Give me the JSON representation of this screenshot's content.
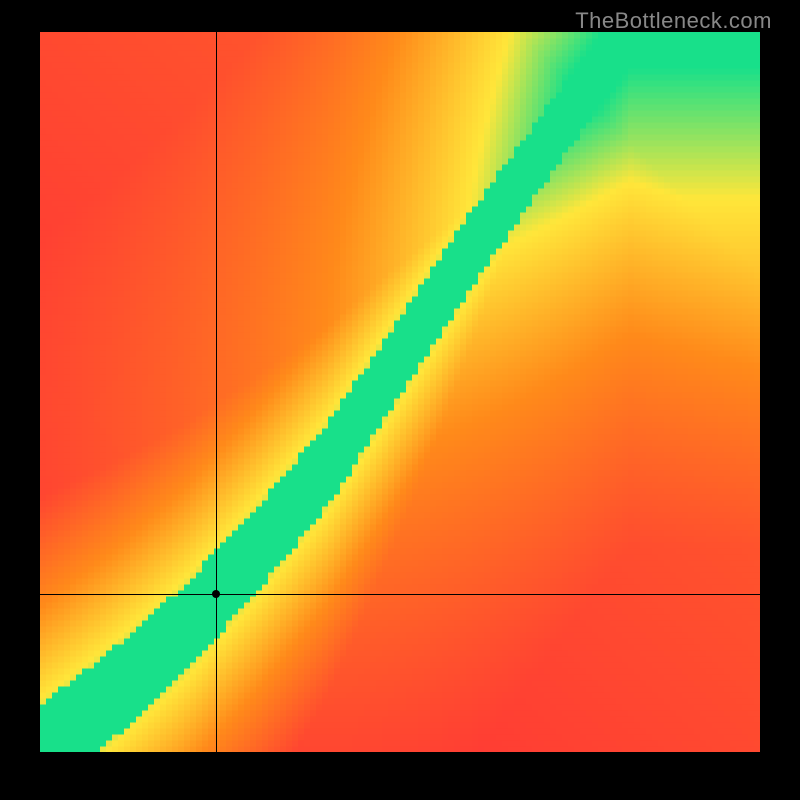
{
  "watermark": "TheBottleneck.com",
  "chart_data": {
    "type": "heatmap",
    "title": "",
    "xlabel": "",
    "ylabel": "",
    "xlim": [
      0,
      1
    ],
    "ylim": [
      0,
      1
    ],
    "grid": 120,
    "colors": {
      "red": "#ff2a3a",
      "orange": "#ff8a1a",
      "yellow": "#ffe63a",
      "green": "#18e08a"
    },
    "crosshair": {
      "x": 0.245,
      "y": 0.22
    },
    "optimum_curve": {
      "description": "Green ridge where GPU is well-matched to CPU; broader at low end, narrower at high end, slope > 1.",
      "points": [
        [
          0.0,
          0.0
        ],
        [
          0.1,
          0.08
        ],
        [
          0.2,
          0.17
        ],
        [
          0.245,
          0.22
        ],
        [
          0.3,
          0.28
        ],
        [
          0.4,
          0.4
        ],
        [
          0.5,
          0.55
        ],
        [
          0.6,
          0.7
        ],
        [
          0.7,
          0.84
        ],
        [
          0.78,
          0.95
        ],
        [
          0.82,
          1.0
        ]
      ]
    }
  }
}
